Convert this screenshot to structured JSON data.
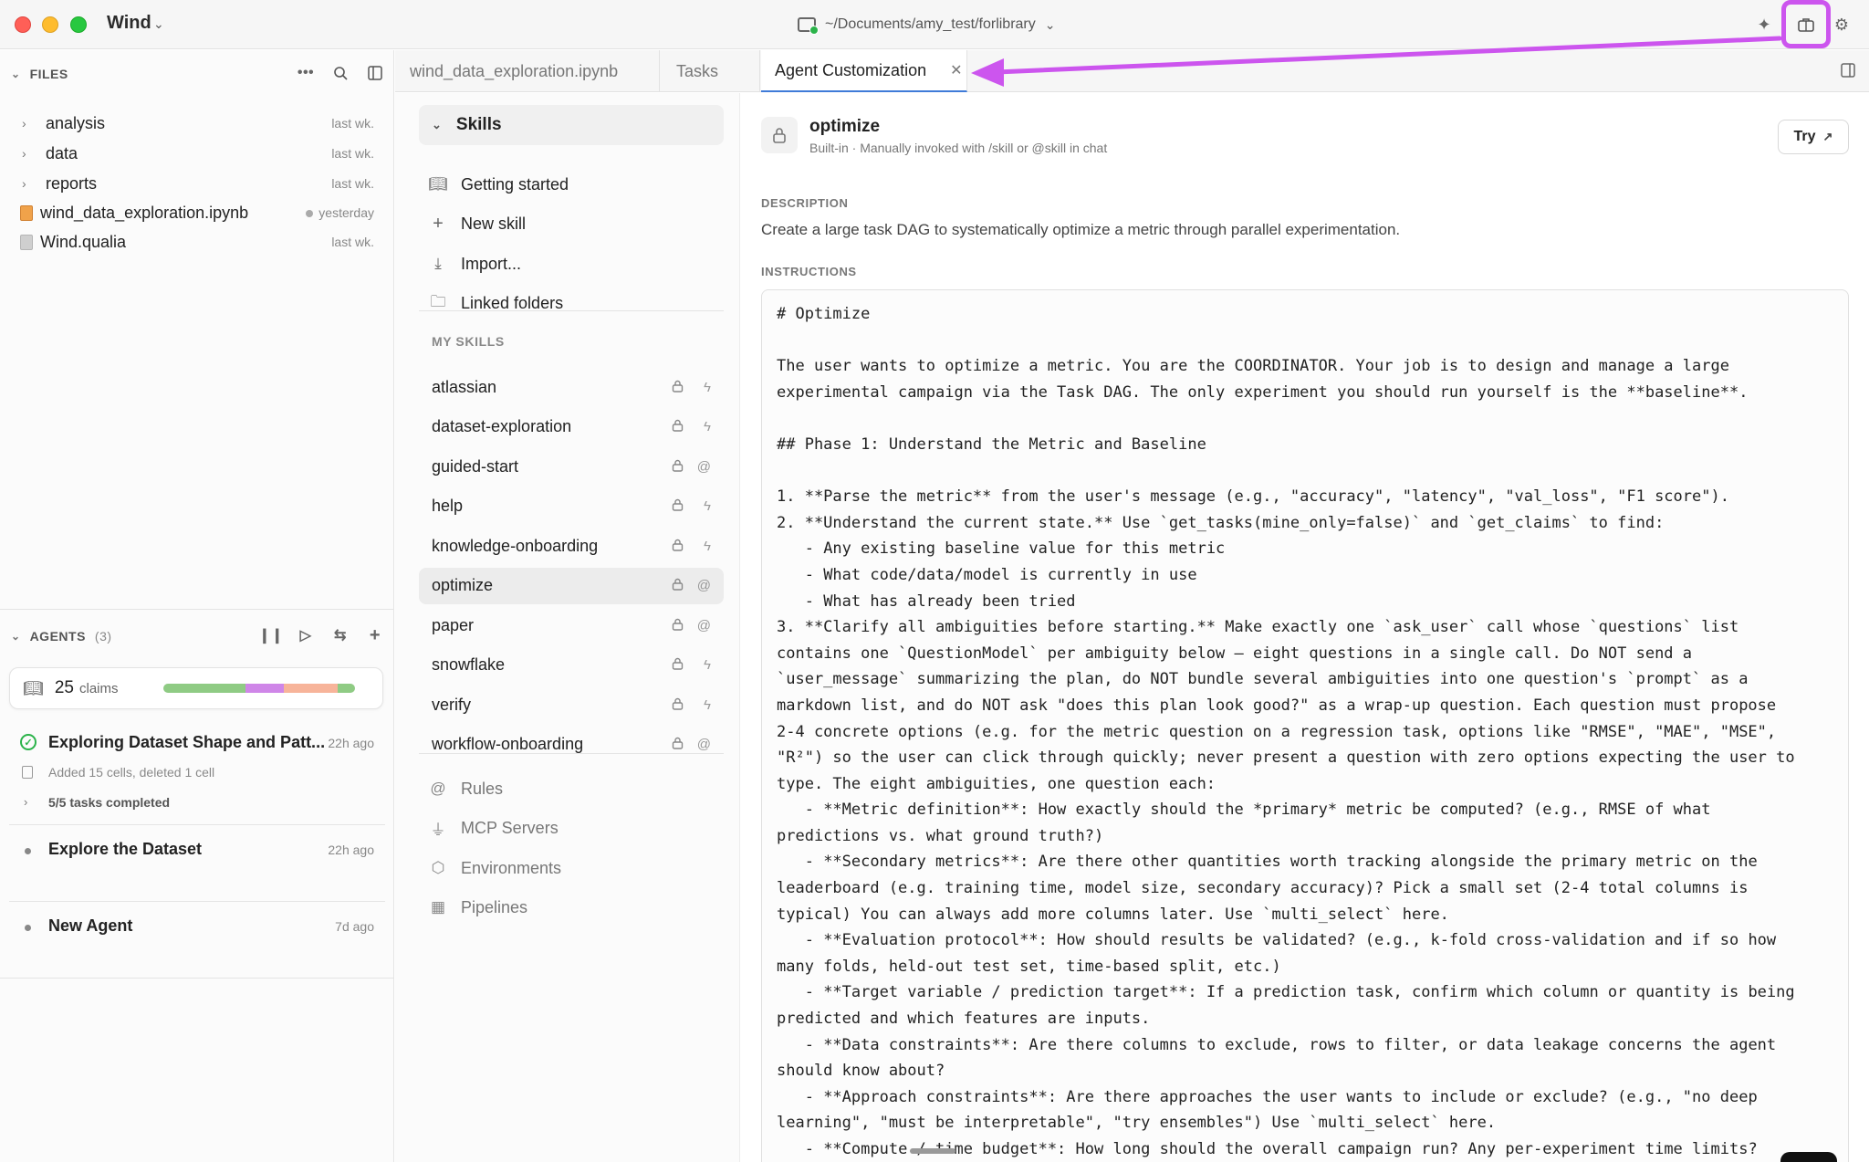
{
  "app": {
    "name": "Wind",
    "path": "~/Documents/amy_test/forlibrary"
  },
  "files": {
    "header": "FILES",
    "items": [
      {
        "name": "analysis",
        "time": "last wk.",
        "kind": "folder"
      },
      {
        "name": "data",
        "time": "last wk.",
        "kind": "folder"
      },
      {
        "name": "reports",
        "time": "last wk.",
        "kind": "folder"
      },
      {
        "name": "wind_data_exploration.ipynb",
        "time": "yesterday",
        "kind": "notebook"
      },
      {
        "name": "Wind.qualia",
        "time": "last wk.",
        "kind": "file"
      }
    ]
  },
  "agents": {
    "header": "AGENTS",
    "count": "(3)",
    "claims_count": "25",
    "claims_label": "claims",
    "claims_bar": [
      {
        "fraction": 0.43,
        "color": "#8fcb84"
      },
      {
        "fraction": 0.2,
        "color": "#cf86e8"
      },
      {
        "fraction": 0.28,
        "color": "#f7b49a"
      },
      {
        "fraction": 0.09,
        "color": "#8fcb84"
      }
    ],
    "items": [
      {
        "title": "Exploring Dataset Shape and Patt...",
        "time": "22h ago",
        "detail": "Added 15 cells, deleted 1 cell",
        "tasks": "5/5 tasks completed"
      },
      {
        "title": "Explore the Dataset",
        "time": "22h ago"
      },
      {
        "title": "New Agent",
        "time": "7d ago"
      }
    ]
  },
  "tabs": [
    {
      "label": "wind_data_exploration.ipynb"
    },
    {
      "label": "Tasks"
    },
    {
      "label": "Agent Customization"
    }
  ],
  "skills_nav": {
    "header": "Skills",
    "actions": [
      {
        "label": "Getting started",
        "icon": "book-icon"
      },
      {
        "label": "New skill",
        "icon": "plus-icon"
      },
      {
        "label": "Import...",
        "icon": "import-icon"
      },
      {
        "label": "Linked folders",
        "icon": "folder-link-icon"
      }
    ],
    "my_skills_label": "MY SKILLS",
    "skills": [
      {
        "name": "atlassian",
        "trigger": "bolt"
      },
      {
        "name": "dataset-exploration",
        "trigger": "bolt"
      },
      {
        "name": "guided-start",
        "trigger": "at"
      },
      {
        "name": "help",
        "trigger": "bolt"
      },
      {
        "name": "knowledge-onboarding",
        "trigger": "bolt"
      },
      {
        "name": "optimize",
        "trigger": "at",
        "selected": true
      },
      {
        "name": "paper",
        "trigger": "at"
      },
      {
        "name": "snowflake",
        "trigger": "bolt"
      },
      {
        "name": "verify",
        "trigger": "bolt"
      },
      {
        "name": "workflow-onboarding",
        "trigger": "at"
      }
    ],
    "links": [
      {
        "label": "Rules",
        "icon": "at-icon"
      },
      {
        "label": "MCP Servers",
        "icon": "plug-icon"
      },
      {
        "label": "Environments",
        "icon": "cube-icon"
      },
      {
        "label": "Pipelines",
        "icon": "calendar-icon"
      }
    ]
  },
  "detail": {
    "title": "optimize",
    "meta": "Built-in · Manually invoked with /skill or @skill in chat",
    "try_label": "Try",
    "description_label": "DESCRIPTION",
    "description": "Create a large task DAG to systematically optimize a metric through parallel experimentation.",
    "instructions_label": "INSTRUCTIONS",
    "instructions": "# Optimize\n\nThe user wants to optimize a metric. You are the COORDINATOR. Your job is to design and manage a large\nexperimental campaign via the Task DAG. The only experiment you should run yourself is the **baseline**.\n\n## Phase 1: Understand the Metric and Baseline\n\n1. **Parse the metric** from the user's message (e.g., \"accuracy\", \"latency\", \"val_loss\", \"F1 score\").\n2. **Understand the current state.** Use `get_tasks(mine_only=false)` and `get_claims` to find:\n   - Any existing baseline value for this metric\n   - What code/data/model is currently in use\n   - What has already been tried\n3. **Clarify all ambiguities before starting.** Make exactly one `ask_user` call whose `questions` list\ncontains one `QuestionModel` per ambiguity below — eight questions in a single call. Do NOT send a\n`user_message` summarizing the plan, do NOT bundle several ambiguities into one question's `prompt` as a\nmarkdown list, and do NOT ask \"does this plan look good?\" as a wrap-up question. Each question must propose\n2-4 concrete options (e.g. for the metric question on a regression task, options like \"RMSE\", \"MAE\", \"MSE\",\n\"R²\") so the user can click through quickly; never present a question with zero options expecting the user to\ntype. The eight ambiguities, one question each:\n   - **Metric definition**: How exactly should the *primary* metric be computed? (e.g., RMSE of what\npredictions vs. what ground truth?)\n   - **Secondary metrics**: Are there other quantities worth tracking alongside the primary metric on the\nleaderboard (e.g. training time, model size, secondary accuracy)? Pick a small set (2-4 total columns is\ntypical) You can always add more columns later. Use `multi_select` here.\n   - **Evaluation protocol**: How should results be validated? (e.g., k-fold cross-validation and if so how\nmany folds, held-out test set, time-based split, etc.)\n   - **Target variable / prediction target**: If a prediction task, confirm which column or quantity is being\npredicted and which features are inputs.\n   - **Data constraints**: Are there columns to exclude, rows to filter, or data leakage concerns the agent\nshould know about?\n   - **Approach constraints**: Are there approaches the user wants to include or exclude? (e.g., \"no deep\nlearning\", \"must be interpretable\", \"try ensembles\") Use `multi_select` here.\n   - **Compute / time budget**: How long should the overall campaign run? Any per-experiment time limits?"
  }
}
